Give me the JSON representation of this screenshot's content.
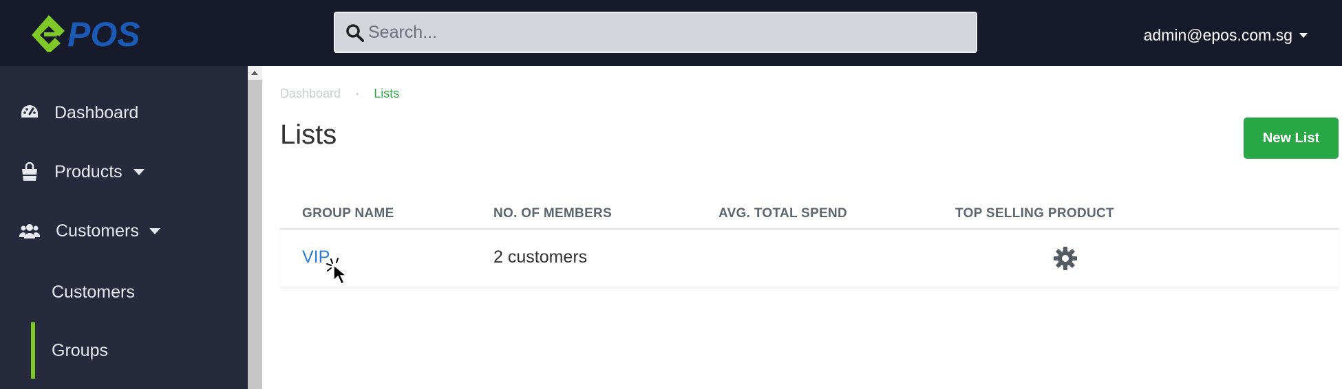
{
  "header": {
    "logo_text": "POS",
    "search_placeholder": "Search...",
    "user_email": "admin@epos.com.sg"
  },
  "sidebar": {
    "items": [
      {
        "label": "Dashboard",
        "icon": "tachometer-icon"
      },
      {
        "label": "Products",
        "icon": "shopping-bag-icon",
        "has_dropdown": true
      },
      {
        "label": "Customers",
        "icon": "users-icon",
        "has_dropdown": true
      }
    ],
    "sub_items": [
      {
        "label": "Customers"
      },
      {
        "label": "Groups",
        "active": true
      }
    ]
  },
  "breadcrumb": [
    "Dashboard",
    "Lists"
  ],
  "page": {
    "title": "Lists",
    "new_button": "New List"
  },
  "table": {
    "columns": [
      "GROUP NAME",
      "NO. OF MEMBERS",
      "AVG. TOTAL SPEND",
      "TOP SELLING PRODUCT"
    ],
    "rows": [
      {
        "group_name": "VIP",
        "members": "2 customers",
        "avg_spend": "",
        "top_product": ""
      }
    ]
  },
  "colors": {
    "topbar": "#171a2b",
    "sidebar": "#262a3c",
    "accent_green": "#28a745",
    "active_bar": "#7ec828",
    "link_blue": "#2e7bd6",
    "logo_green": "#7ec828",
    "logo_blue": "#1b5bb5"
  }
}
